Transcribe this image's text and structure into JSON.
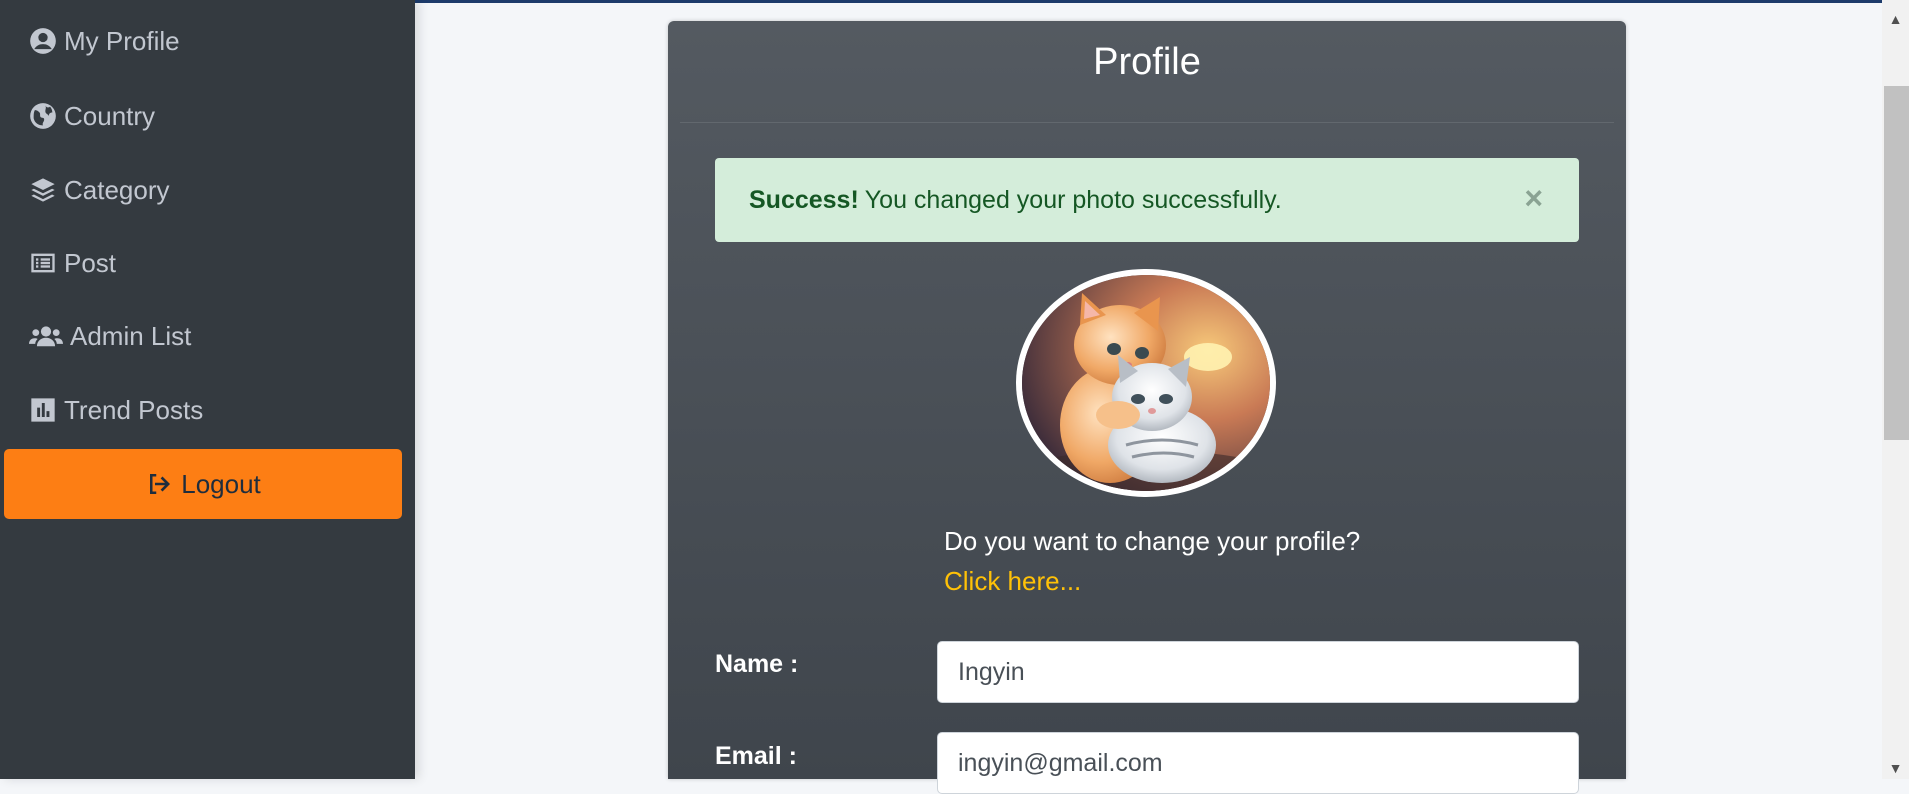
{
  "sidebar": {
    "items": [
      {
        "label": "My Profile",
        "icon": "user-circle-icon"
      },
      {
        "label": "Country",
        "icon": "globe-icon"
      },
      {
        "label": "Category",
        "icon": "layers-icon"
      },
      {
        "label": "Post",
        "icon": "list-alt-icon"
      },
      {
        "label": "Admin List",
        "icon": "users-icon"
      },
      {
        "label": "Trend Posts",
        "icon": "chart-bar-icon"
      }
    ],
    "logout_label": "Logout"
  },
  "profile": {
    "title": "Profile",
    "alert": {
      "strong": "Success!",
      "message": "You changed your photo successfully.",
      "close": "×"
    },
    "change_prompt": "Do you want to change your profile?",
    "change_link": "Click here...",
    "fields": {
      "name_label": "Name :",
      "name_value": "Ingyin",
      "email_label": "Email :",
      "email_value": "ingyin@gmail.com"
    }
  },
  "colors": {
    "sidebar_bg": "#343a40",
    "logout_bg": "#fd7e14",
    "alert_bg": "#d4edda",
    "link": "#ffc107"
  }
}
